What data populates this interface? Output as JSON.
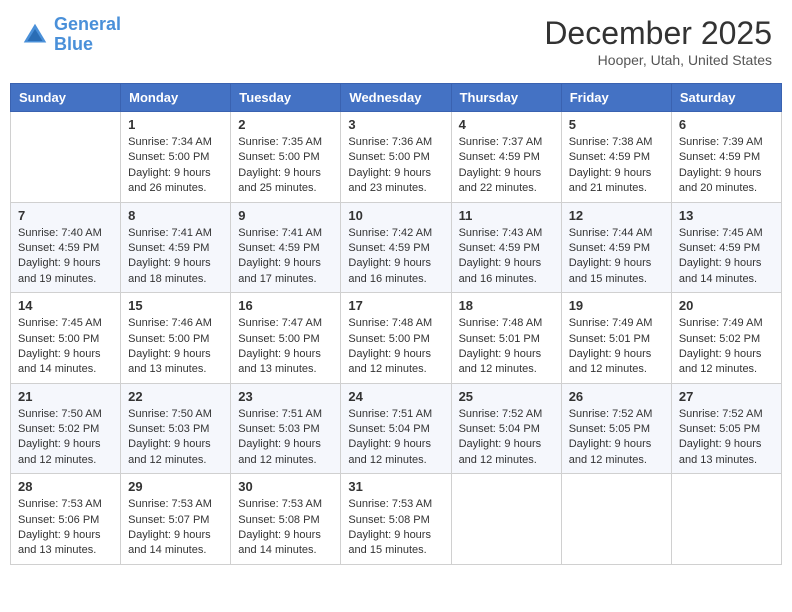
{
  "header": {
    "logo_line1": "General",
    "logo_line2": "Blue",
    "month": "December 2025",
    "location": "Hooper, Utah, United States"
  },
  "days_of_week": [
    "Sunday",
    "Monday",
    "Tuesday",
    "Wednesday",
    "Thursday",
    "Friday",
    "Saturday"
  ],
  "weeks": [
    [
      {
        "day": "",
        "info": ""
      },
      {
        "day": "1",
        "info": "Sunrise: 7:34 AM\nSunset: 5:00 PM\nDaylight: 9 hours\nand 26 minutes."
      },
      {
        "day": "2",
        "info": "Sunrise: 7:35 AM\nSunset: 5:00 PM\nDaylight: 9 hours\nand 25 minutes."
      },
      {
        "day": "3",
        "info": "Sunrise: 7:36 AM\nSunset: 5:00 PM\nDaylight: 9 hours\nand 23 minutes."
      },
      {
        "day": "4",
        "info": "Sunrise: 7:37 AM\nSunset: 4:59 PM\nDaylight: 9 hours\nand 22 minutes."
      },
      {
        "day": "5",
        "info": "Sunrise: 7:38 AM\nSunset: 4:59 PM\nDaylight: 9 hours\nand 21 minutes."
      },
      {
        "day": "6",
        "info": "Sunrise: 7:39 AM\nSunset: 4:59 PM\nDaylight: 9 hours\nand 20 minutes."
      }
    ],
    [
      {
        "day": "7",
        "info": "Sunrise: 7:40 AM\nSunset: 4:59 PM\nDaylight: 9 hours\nand 19 minutes."
      },
      {
        "day": "8",
        "info": "Sunrise: 7:41 AM\nSunset: 4:59 PM\nDaylight: 9 hours\nand 18 minutes."
      },
      {
        "day": "9",
        "info": "Sunrise: 7:41 AM\nSunset: 4:59 PM\nDaylight: 9 hours\nand 17 minutes."
      },
      {
        "day": "10",
        "info": "Sunrise: 7:42 AM\nSunset: 4:59 PM\nDaylight: 9 hours\nand 16 minutes."
      },
      {
        "day": "11",
        "info": "Sunrise: 7:43 AM\nSunset: 4:59 PM\nDaylight: 9 hours\nand 16 minutes."
      },
      {
        "day": "12",
        "info": "Sunrise: 7:44 AM\nSunset: 4:59 PM\nDaylight: 9 hours\nand 15 minutes."
      },
      {
        "day": "13",
        "info": "Sunrise: 7:45 AM\nSunset: 4:59 PM\nDaylight: 9 hours\nand 14 minutes."
      }
    ],
    [
      {
        "day": "14",
        "info": "Sunrise: 7:45 AM\nSunset: 5:00 PM\nDaylight: 9 hours\nand 14 minutes."
      },
      {
        "day": "15",
        "info": "Sunrise: 7:46 AM\nSunset: 5:00 PM\nDaylight: 9 hours\nand 13 minutes."
      },
      {
        "day": "16",
        "info": "Sunrise: 7:47 AM\nSunset: 5:00 PM\nDaylight: 9 hours\nand 13 minutes."
      },
      {
        "day": "17",
        "info": "Sunrise: 7:48 AM\nSunset: 5:00 PM\nDaylight: 9 hours\nand 12 minutes."
      },
      {
        "day": "18",
        "info": "Sunrise: 7:48 AM\nSunset: 5:01 PM\nDaylight: 9 hours\nand 12 minutes."
      },
      {
        "day": "19",
        "info": "Sunrise: 7:49 AM\nSunset: 5:01 PM\nDaylight: 9 hours\nand 12 minutes."
      },
      {
        "day": "20",
        "info": "Sunrise: 7:49 AM\nSunset: 5:02 PM\nDaylight: 9 hours\nand 12 minutes."
      }
    ],
    [
      {
        "day": "21",
        "info": "Sunrise: 7:50 AM\nSunset: 5:02 PM\nDaylight: 9 hours\nand 12 minutes."
      },
      {
        "day": "22",
        "info": "Sunrise: 7:50 AM\nSunset: 5:03 PM\nDaylight: 9 hours\nand 12 minutes."
      },
      {
        "day": "23",
        "info": "Sunrise: 7:51 AM\nSunset: 5:03 PM\nDaylight: 9 hours\nand 12 minutes."
      },
      {
        "day": "24",
        "info": "Sunrise: 7:51 AM\nSunset: 5:04 PM\nDaylight: 9 hours\nand 12 minutes."
      },
      {
        "day": "25",
        "info": "Sunrise: 7:52 AM\nSunset: 5:04 PM\nDaylight: 9 hours\nand 12 minutes."
      },
      {
        "day": "26",
        "info": "Sunrise: 7:52 AM\nSunset: 5:05 PM\nDaylight: 9 hours\nand 12 minutes."
      },
      {
        "day": "27",
        "info": "Sunrise: 7:52 AM\nSunset: 5:05 PM\nDaylight: 9 hours\nand 13 minutes."
      }
    ],
    [
      {
        "day": "28",
        "info": "Sunrise: 7:53 AM\nSunset: 5:06 PM\nDaylight: 9 hours\nand 13 minutes."
      },
      {
        "day": "29",
        "info": "Sunrise: 7:53 AM\nSunset: 5:07 PM\nDaylight: 9 hours\nand 14 minutes."
      },
      {
        "day": "30",
        "info": "Sunrise: 7:53 AM\nSunset: 5:08 PM\nDaylight: 9 hours\nand 14 minutes."
      },
      {
        "day": "31",
        "info": "Sunrise: 7:53 AM\nSunset: 5:08 PM\nDaylight: 9 hours\nand 15 minutes."
      },
      {
        "day": "",
        "info": ""
      },
      {
        "day": "",
        "info": ""
      },
      {
        "day": "",
        "info": ""
      }
    ]
  ]
}
